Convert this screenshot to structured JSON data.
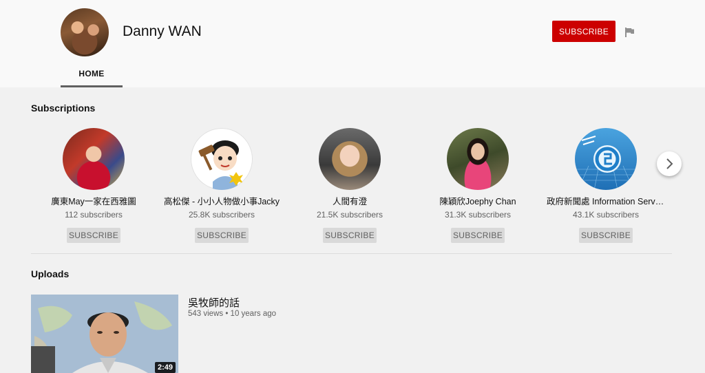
{
  "channel": {
    "name": "Danny WAN",
    "subscribe_label": "SUBSCRIBE",
    "tabs": [
      {
        "label": "HOME",
        "active": true
      }
    ],
    "brand_color": "#cc0000"
  },
  "subscriptions": {
    "title": "Subscriptions",
    "items": [
      {
        "name": "廣東May一家在西雅圖",
        "subscribers": "112 subscribers",
        "button": "SUBSCRIBE"
      },
      {
        "name": "高松傑 - 小小人物做小事Jacky",
        "subscribers": "25.8K subscribers",
        "button": "SUBSCRIBE"
      },
      {
        "name": "人間有澄",
        "subscribers": "21.5K subscribers",
        "button": "SUBSCRIBE"
      },
      {
        "name": "陳穎欣Joephy Chan",
        "subscribers": "31.3K subscribers",
        "button": "SUBSCRIBE"
      },
      {
        "name": "政府新聞處 Information Services Department",
        "subscribers": "43.1K subscribers",
        "button": "SUBSCRIBE"
      }
    ]
  },
  "uploads": {
    "title": "Uploads",
    "videos": [
      {
        "title": "吳牧師的話",
        "meta": "543 views • 10 years ago",
        "duration": "2:49"
      }
    ]
  }
}
